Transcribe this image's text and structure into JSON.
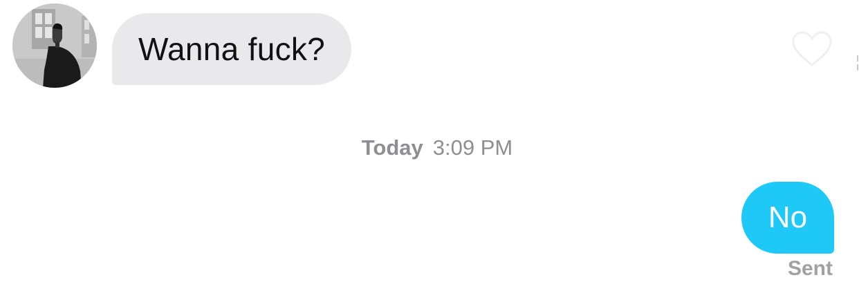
{
  "conversation": {
    "incoming_message": {
      "text": "Wanna fuck?",
      "bubble_color": "#e9e9eb",
      "text_color": "#111111"
    },
    "timestamp": {
      "day": "Today",
      "time": "3:09 PM",
      "color": "#8e8e93"
    },
    "outgoing_message": {
      "text": "No",
      "bubble_color": "#1ec8f7",
      "text_color": "#ffffff",
      "status": "Sent"
    }
  },
  "icons": {
    "avatar": "avatar-photo",
    "like": "heart-outline-icon"
  }
}
